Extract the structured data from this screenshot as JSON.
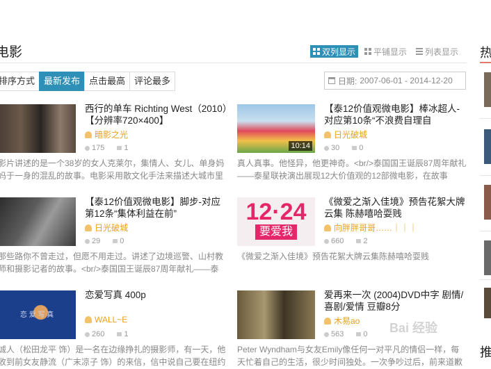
{
  "section": {
    "title": "电影"
  },
  "views": [
    {
      "label": "双列显示",
      "active": true
    },
    {
      "label": "平铺显示",
      "active": false
    },
    {
      "label": "列表显示",
      "active": false
    }
  ],
  "sort": {
    "label": "排序方式",
    "tabs": [
      "最新发布",
      "点击最高",
      "评论最多"
    ]
  },
  "date_filter": {
    "label": "日期:",
    "value": "2007-06-01 - 2014-12-20"
  },
  "items": [
    {
      "title": "西行的单车 Richting West（2010）【分辨率720×400】",
      "author": "暗影之光",
      "views": "175",
      "comments": "1",
      "desc": "影片讲述的是一个38岁的女人克莱尔，集情人、女儿、单身妈妈于一身的混乱的故事。电影采用散文化手法来描述大城市里"
    },
    {
      "title": "【泰12价值观微电影】棒冰超人-对应第10条“不浪费自理自",
      "author": "日光破城",
      "views": "30",
      "comments": "0",
      "duration": "10:14",
      "desc": "真人真事。他怪异，他更神奇。<br/>泰国国王诞辰87周年献礼——泰星联袂演出展现12大价值观的12部微电影，在故事"
    },
    {
      "title": "【泰12价值观微电影】脚步-对应第12条“集体利益在前”",
      "author": "日光破城",
      "views": "29",
      "comments": "0",
      "desc": "那些路你不曾走过，但愿不用走过。讲述了边境巡警、山村教师和摄影记者的故事。<br/>泰国国王诞辰87周年献礼——泰"
    },
    {
      "title": "《微爱之渐入佳境》预告花絮大牌云集 陈赫嘻哈耍贱",
      "author": "向胖胖哥哥……｜｜｜",
      "views": "660",
      "comments": "2",
      "thumb_text1": "12·24",
      "thumb_text2": "要爱我",
      "desc": "《微爱之渐入佳境》预告花絮大牌云集陈赫嘻哈耍贱"
    },
    {
      "title": "恋爱写真 400p",
      "author": "WALL~E",
      "views": "260",
      "comments": "1",
      "thumb_text1": "恋 爱 写 真",
      "desc": "诚人（松田龙平 饰）是一名在边缘挣扎的摄影师，有一天，他收到前女友静流（广末凉子 饰）的来信，信中说自己要在纽约"
    },
    {
      "title": "爱再来一次 (2004)DVD中字 剧情/喜剧/爱情 豆瓣8分",
      "author": "木易ao",
      "views": "563",
      "comments": "0",
      "desc": "Peter Wyndham与女友Emily像任何一对平凡的情侣一样，每天忙着自己的生活，很少时间独处。一次争吵过后，前来道歉"
    }
  ],
  "sidebar": {
    "title": "热",
    "title2": "推"
  },
  "watermark": "Bai 经验",
  "colors": {
    "accent": "#2e8fb7",
    "author": "#e8a11a"
  }
}
